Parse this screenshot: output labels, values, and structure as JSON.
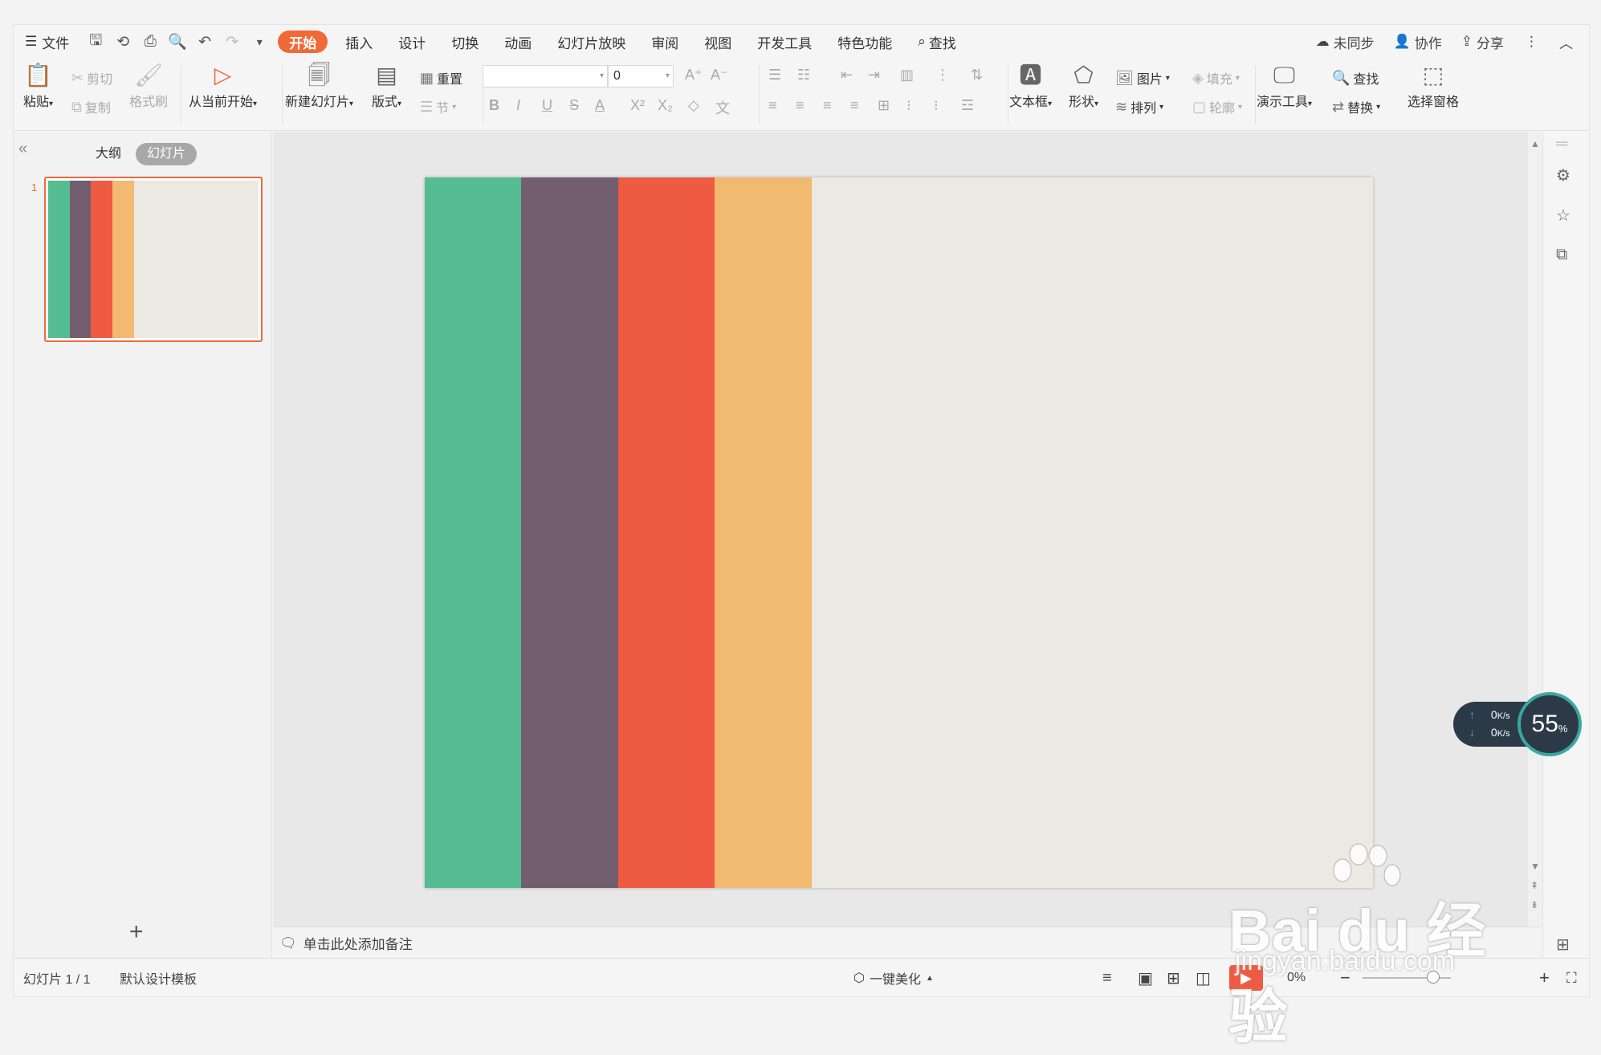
{
  "menu": {
    "file": "文件",
    "tabs": [
      "开始",
      "插入",
      "设计",
      "切换",
      "动画",
      "幻灯片放映",
      "审阅",
      "视图",
      "开发工具",
      "特色功能"
    ],
    "search": "查找",
    "right": {
      "sync": "未同步",
      "collab": "协作",
      "share": "分享"
    }
  },
  "ribbon": {
    "paste": "粘贴",
    "cut": "剪切",
    "copy": "复制",
    "format_painter": "格式刷",
    "from_current": "从当前开始",
    "new_slide": "新建幻灯片",
    "layout": "版式",
    "reset": "重置",
    "section": "节",
    "font_name": "",
    "font_size": "0",
    "text_box": "文本框",
    "shape": "形状",
    "picture": "图片",
    "fill": "填充",
    "arrange": "排列",
    "outline": "轮廓",
    "present_tools": "演示工具",
    "find": "查找",
    "replace": "替换",
    "select_pane": "选择窗格"
  },
  "leftpanel": {
    "outline_tab": "大纲",
    "slides_tab": "幻灯片",
    "slide_number": "1"
  },
  "slide": {
    "stripes": [
      "#56bc91",
      "#725e6e",
      "#ef5b42",
      "#f2b970"
    ],
    "background": "#ebe9e2"
  },
  "notes": {
    "placeholder": "单击此处添加备注"
  },
  "status": {
    "slide_count": "幻灯片 1 / 1",
    "template": "默认设计模板",
    "beautify": "一键美化",
    "zoom": "0%"
  },
  "network": {
    "up": "0",
    "down": "0",
    "unit": "K/s",
    "percent": "55",
    "percent_sign": "%"
  },
  "watermark": {
    "brand": "Bai du 经验",
    "url": "jingyan.baidu.com"
  }
}
